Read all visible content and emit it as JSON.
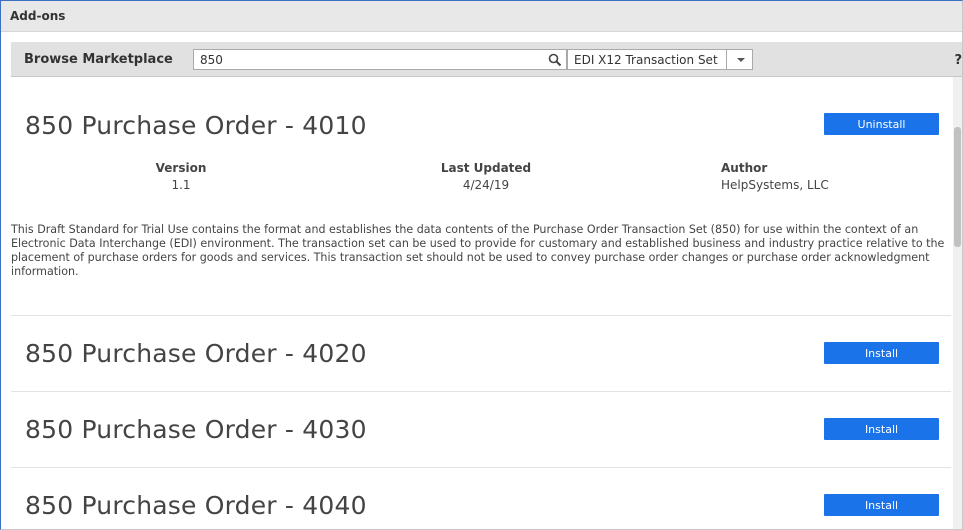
{
  "window": {
    "title": "Add-ons"
  },
  "toolbar": {
    "browse_label": "Browse Marketplace",
    "search_value": "850",
    "filter_selected": "EDI X12 Transaction Set",
    "help_label": "?"
  },
  "addons": [
    {
      "title": "850 Purchase Order - 4010",
      "button": "Uninstall",
      "version_label": "Version",
      "version": "1.1",
      "updated_label": "Last Updated",
      "updated": "4/24/19",
      "author_label": "Author",
      "author": "HelpSystems, LLC",
      "description": "This Draft Standard for Trial Use contains the format and establishes the data contents of the Purchase Order Transaction Set (850) for use within the context of an Electronic Data Interchange (EDI) environment. The transaction set can be used to provide for customary and established business and industry practice relative to the placement of purchase orders for goods and services. This transaction set should not be used to convey purchase order changes or purchase order acknowledgment information."
    },
    {
      "title": "850 Purchase Order - 4020",
      "button": "Install"
    },
    {
      "title": "850 Purchase Order - 4030",
      "button": "Install"
    },
    {
      "title": "850 Purchase Order - 4040",
      "button": "Install"
    }
  ],
  "colors": {
    "accent": "#1a73e8",
    "header_bg": "#e8e8e8",
    "toolbar_bg": "#e1e1e1"
  }
}
